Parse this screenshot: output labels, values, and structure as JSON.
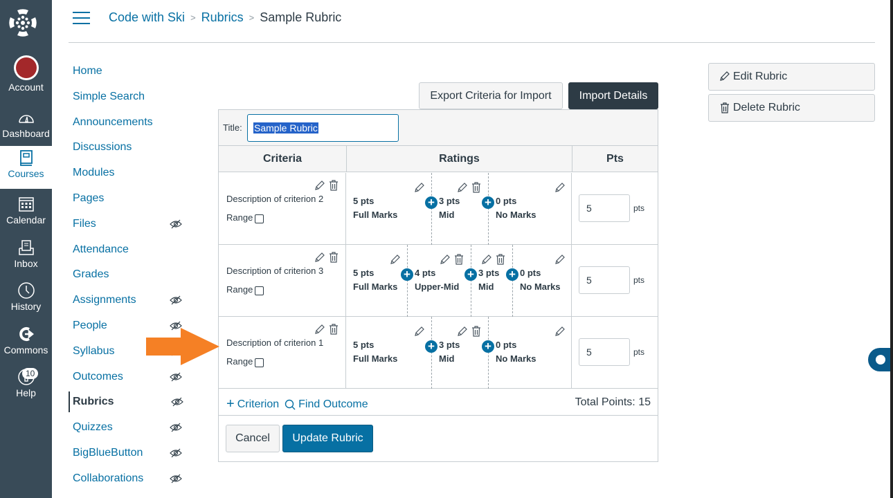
{
  "global_nav": {
    "items": [
      {
        "label": "Account",
        "icon": "account-avatar"
      },
      {
        "label": "Dashboard",
        "icon": "dashboard-gauge-icon"
      },
      {
        "label": "Courses",
        "icon": "courses-book-icon",
        "active": true
      },
      {
        "label": "Calendar",
        "icon": "calendar-icon"
      },
      {
        "label": "Inbox",
        "icon": "inbox-icon"
      },
      {
        "label": "History",
        "icon": "clock-icon"
      },
      {
        "label": "Commons",
        "icon": "commons-icon"
      },
      {
        "label": "Help",
        "icon": "help-icon",
        "badge": "10"
      }
    ]
  },
  "breadcrumb": {
    "course": "Code with Ski",
    "section": "Rubrics",
    "current": "Sample Rubric",
    "separator": ">"
  },
  "course_nav": {
    "items": [
      {
        "label": "Home",
        "hidden": false
      },
      {
        "label": "Simple Search",
        "hidden": false
      },
      {
        "label": "Announcements",
        "hidden": false
      },
      {
        "label": "Discussions",
        "hidden": false
      },
      {
        "label": "Modules",
        "hidden": false
      },
      {
        "label": "Pages",
        "hidden": false
      },
      {
        "label": "Files",
        "hidden": true
      },
      {
        "label": "Attendance",
        "hidden": false
      },
      {
        "label": "Grades",
        "hidden": false
      },
      {
        "label": "Assignments",
        "hidden": true
      },
      {
        "label": "People",
        "hidden": true
      },
      {
        "label": "Syllabus",
        "hidden": true
      },
      {
        "label": "Outcomes",
        "hidden": true
      },
      {
        "label": "Rubrics",
        "hidden": true,
        "active": true
      },
      {
        "label": "Quizzes",
        "hidden": true
      },
      {
        "label": "BigBlueButton",
        "hidden": true
      },
      {
        "label": "Collaborations",
        "hidden": true
      }
    ]
  },
  "toolbar": {
    "export_label": "Export Criteria for Import",
    "import_label": "Import Details"
  },
  "rubric": {
    "title_label": "Title:",
    "title_value": "Sample Rubric",
    "headers": {
      "criteria": "Criteria",
      "ratings": "Ratings",
      "pts": "Pts"
    },
    "range_label": "Range",
    "pts_unit": "pts",
    "criteria": [
      {
        "description": "Description of criterion 2",
        "points": "5",
        "ratings": [
          {
            "pts": "5 pts",
            "label": "Full Marks"
          },
          {
            "pts": "3 pts",
            "label": "Mid"
          },
          {
            "pts": "0 pts",
            "label": "No Marks"
          }
        ]
      },
      {
        "description": "Description of criterion 3",
        "points": "5",
        "ratings": [
          {
            "pts": "5 pts",
            "label": "Full Marks"
          },
          {
            "pts": "4 pts",
            "label": "Upper-Mid"
          },
          {
            "pts": "3 pts",
            "label": "Mid"
          },
          {
            "pts": "0 pts",
            "label": "No Marks"
          }
        ]
      },
      {
        "description": "Description of criterion 1",
        "points": "5",
        "ratings": [
          {
            "pts": "5 pts",
            "label": "Full Marks"
          },
          {
            "pts": "3 pts",
            "label": "Mid"
          },
          {
            "pts": "0 pts",
            "label": "No Marks"
          }
        ]
      }
    ],
    "add_criterion_label": "Criterion",
    "find_outcome_label": "Find Outcome",
    "total_points": "Total Points: 15",
    "cancel_label": "Cancel",
    "update_label": "Update Rubric"
  },
  "side_actions": {
    "edit_label": "Edit Rubric",
    "delete_label": "Delete Rubric"
  },
  "colors": {
    "nav_bg": "#394b58",
    "link": "#0770a3",
    "primary": "#0770a3",
    "dark_button": "#2d3b45",
    "annotation_arrow": "#f58025"
  }
}
